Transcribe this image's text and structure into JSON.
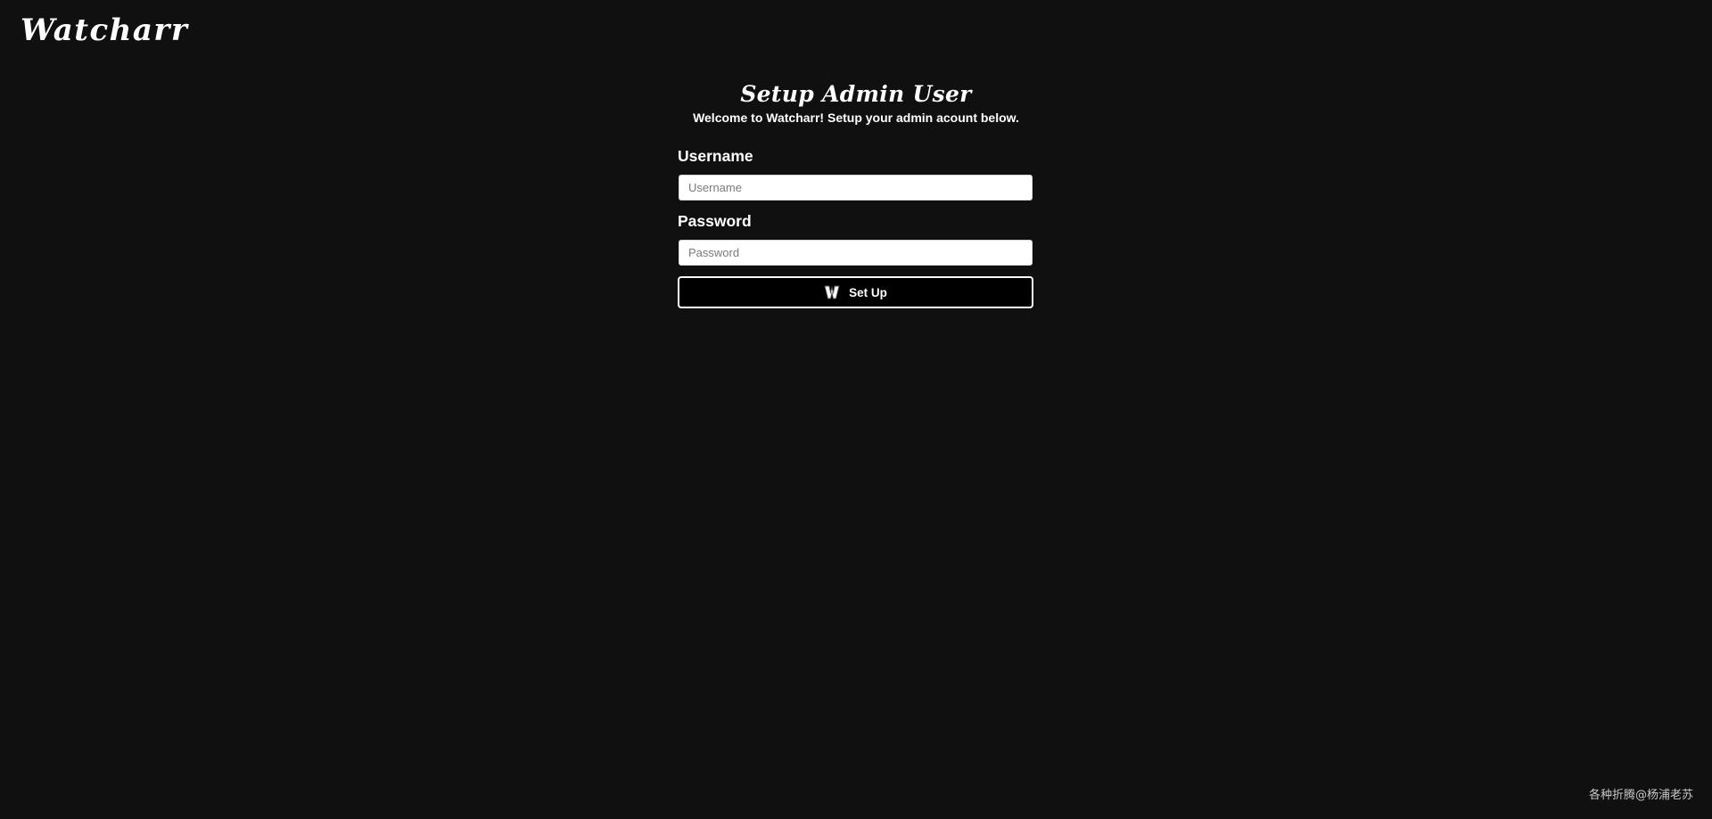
{
  "header": {
    "logo_text": "Watcharr"
  },
  "setup": {
    "title": "Setup Admin User",
    "subtitle": "Welcome to Watcharr! Setup your admin acount below.",
    "username": {
      "label": "Username",
      "placeholder": "Username",
      "value": ""
    },
    "password": {
      "label": "Password",
      "placeholder": "Password",
      "value": ""
    },
    "submit": {
      "label": "Set Up",
      "icon": "watcharr-w-logo-icon"
    }
  },
  "watermark": {
    "text": "各种折腾@杨浦老苏"
  },
  "colors": {
    "background": "#101010",
    "text": "#ffffff",
    "input_background": "#ffffff",
    "button_background": "#000000",
    "button_border": "#ffffff",
    "placeholder": "#7a7a7a"
  }
}
